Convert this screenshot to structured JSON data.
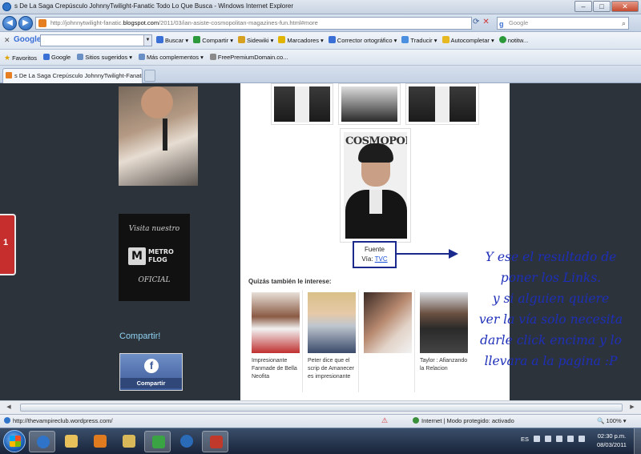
{
  "window": {
    "title": "s De La Saga Crepúsculo JohnnyTwilight-Fanatic Todo Lo Que Busca - Windows Internet Explorer"
  },
  "address_bar": {
    "url_prefix": "http://johnnytwilight-fanatic.",
    "url_domain": "blogspot.com",
    "url_suffix": "/2011/03/ian-asiste-cosmopolitan-magazines-fun.html#more",
    "search_placeholder": "Google"
  },
  "google_toolbar": {
    "logo": "Google",
    "items": [
      "Buscar ▾",
      "Compartir ▾",
      "Sidewiki ▾",
      "Marcadores ▾",
      "Corrector ortográfico ▾",
      "Traducir ▾",
      "Autocompletar ▾",
      "notitw..."
    ]
  },
  "favorites_bar": {
    "items": [
      "Favoritos",
      "Google",
      "Sitios sugeridos ▾",
      "Más complementos ▾",
      "FreePremiumDomain.co..."
    ]
  },
  "tab": {
    "label": "s De La Saga Crepúsculo JohnnyTwilight-Fanatic ..."
  },
  "sidebar": {
    "side_tab_label": "1",
    "metroflog_top": "Visita nuestro",
    "metroflog_logo_letter": "M",
    "metroflog_logo_text_1": "METRO",
    "metroflog_logo_text_2": "FLOG",
    "metroflog_bottom": "OFICIAL",
    "share_title": "Compartir!",
    "share_button": "Compartir",
    "share_icon": "f"
  },
  "post": {
    "photo_brand": "COSMOPOL",
    "source_label": "Fuente",
    "via_label": "Vía:",
    "via_link": "TVC",
    "related_title": "Quizás también le interese:",
    "related": [
      {
        "caption": "Impresionante Fanmade de Bella Neofita"
      },
      {
        "caption": "Peter dice que el scrip de Amanecer es impresionante"
      },
      {
        "caption": ""
      },
      {
        "caption": "Taylor : Afianzando la Relacion"
      }
    ]
  },
  "annotation": {
    "lines": [
      "Y ese el resultado de",
      "poner los Links.",
      "y si alguien quiere",
      "ver la vía solo necesita",
      "darle click encima y lo",
      "llevara a la pagina :P"
    ]
  },
  "status_bar": {
    "url": "http://thevampireclub.wordpress.com/",
    "zone": "Internet | Modo protegido: activado",
    "zoom": "100%"
  },
  "taskbar": {
    "language": "ES",
    "time": "02:30 p.m.",
    "date": "08/03/2011"
  }
}
